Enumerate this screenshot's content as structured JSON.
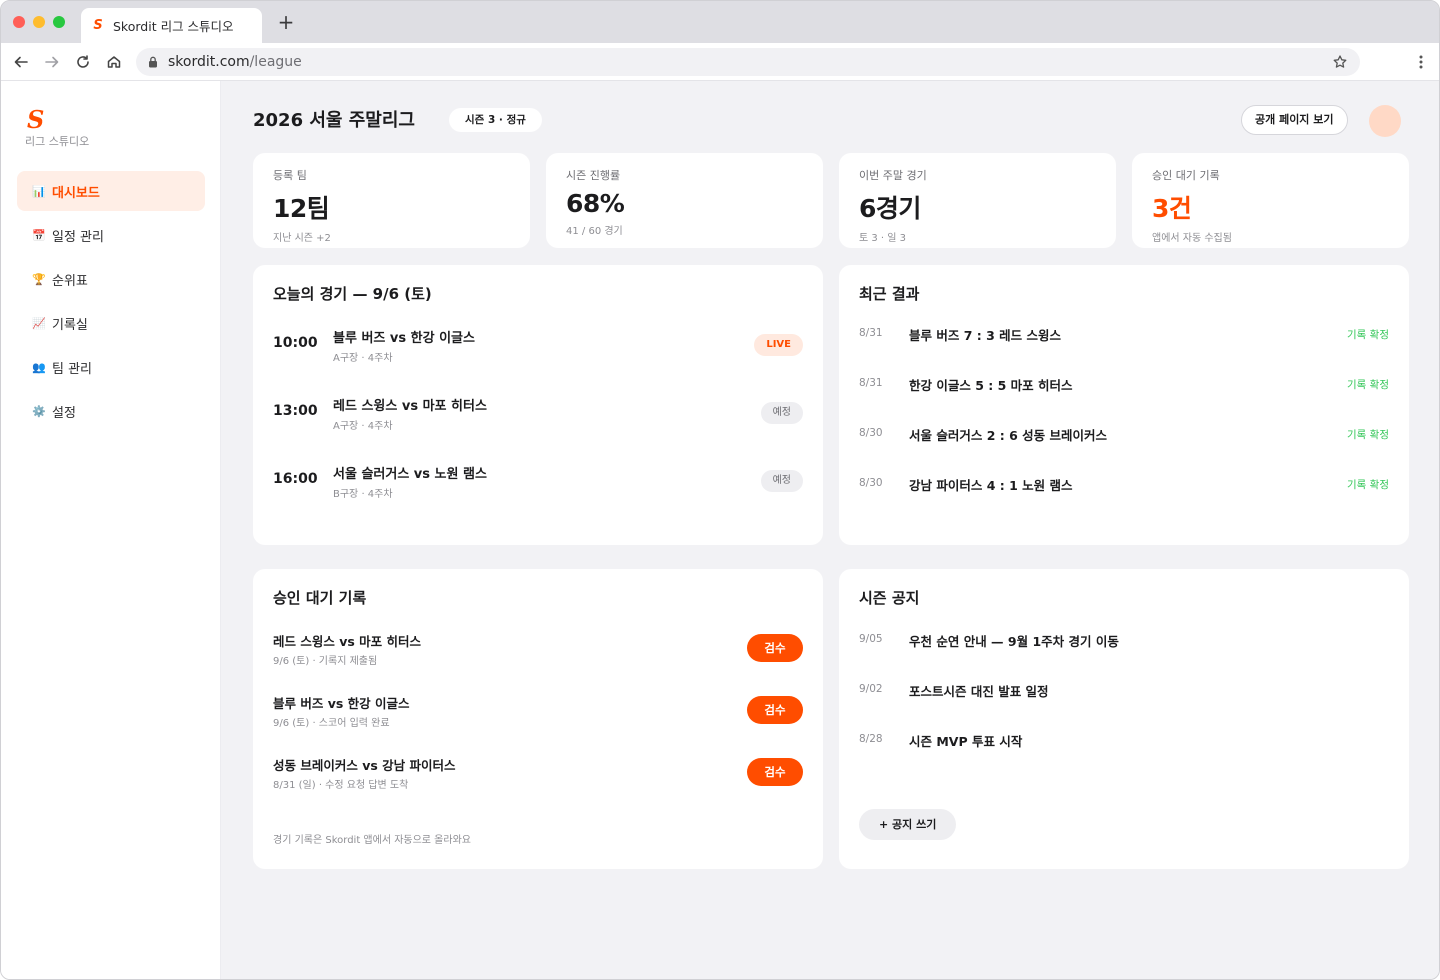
{
  "browser": {
    "tab_title": "Skordit 리그 스튜디오",
    "tab_logo": "S",
    "new_tab": "+",
    "url_host": "skordit.com",
    "url_path": "/league"
  },
  "sidebar": {
    "logo": "S",
    "subtitle": "리그 스튜디오",
    "items": [
      {
        "label": "대시보드",
        "icon": "bar-chart-icon",
        "glyph": "📊"
      },
      {
        "label": "일정 관리",
        "icon": "calendar-icon",
        "glyph": "📅"
      },
      {
        "label": "순위표",
        "icon": "trophy-icon",
        "glyph": "🏆"
      },
      {
        "label": "기록실",
        "icon": "line-chart-icon",
        "glyph": "📈"
      },
      {
        "label": "팀 관리",
        "icon": "users-icon",
        "glyph": "👥"
      },
      {
        "label": "설정",
        "icon": "gear-icon",
        "glyph": "⚙️"
      }
    ]
  },
  "header": {
    "title": "2026 서울 주말리그",
    "season_pill": "시즌 3 · 정규",
    "public_button": "공개 페이지 보기"
  },
  "stats": [
    {
      "label": "등록 팀",
      "value": "12팀",
      "sub": "지난 시즌 +2"
    },
    {
      "label": "시즌 진행률",
      "value": "68%",
      "sub": "41 / 60 경기"
    },
    {
      "label": "이번 주말 경기",
      "value": "6경기",
      "sub": "토 3 · 일 3"
    },
    {
      "label": "승인 대기 기록",
      "value": "3건",
      "sub": "앱에서 자동 수집됨"
    }
  ],
  "today": {
    "title": "오늘의 경기 — 9/6 (토)",
    "games": [
      {
        "time": "10:00",
        "match": "블루 버즈 vs 한강 이글스",
        "meta": "A구장 · 4주차",
        "status": "LIVE"
      },
      {
        "time": "13:00",
        "match": "레드 스윙스 vs 마포 히터스",
        "meta": "A구장 · 4주차",
        "status": "예정"
      },
      {
        "time": "16:00",
        "match": "서울 슬러거스 vs 노원 램스",
        "meta": "B구장 · 4주차",
        "status": "예정"
      }
    ]
  },
  "results": {
    "title": "최근 결과",
    "items": [
      {
        "date": "8/31",
        "text": "블루 버즈 7 : 3 레드 스윙스",
        "status": "기록 확정"
      },
      {
        "date": "8/31",
        "text": "한강 이글스 5 : 5 마포 히터스",
        "status": "기록 확정"
      },
      {
        "date": "8/30",
        "text": "서울 슬러거스 2 : 6 성동 브레이커스",
        "status": "기록 확정"
      },
      {
        "date": "8/30",
        "text": "강남 파이터스 4 : 1 노원 램스",
        "status": "기록 확정"
      }
    ]
  },
  "approvals": {
    "title": "승인 대기 기록",
    "items": [
      {
        "title": "레드 스윙스 vs 마포 히터스",
        "meta": "9/6 (토) · 기록지 제출됨",
        "button": "검수"
      },
      {
        "title": "블루 버즈 vs 한강 이글스",
        "meta": "9/6 (토) · 스코어 입력 완료",
        "button": "검수"
      },
      {
        "title": "성동 브레이커스 vs 강남 파이터스",
        "meta": "8/31 (일) · 수정 요청 답변 도착",
        "button": "검수"
      }
    ],
    "footnote": "경기 기록은 Skordit 앱에서 자동으로 올라와요"
  },
  "notices": {
    "title": "시즌 공지",
    "items": [
      {
        "date": "9/05",
        "text": "우천 순연 안내 — 9월 1주차 경기 이동"
      },
      {
        "date": "9/02",
        "text": "포스트시즌 대진 발표 일정"
      },
      {
        "date": "8/28",
        "text": "시즌 MVP 투표 시작"
      }
    ],
    "button": "+ 공지 쓰기"
  },
  "colors": {
    "accent": "#ff4d00",
    "success": "#34c759",
    "background": "#f2f2f5"
  }
}
